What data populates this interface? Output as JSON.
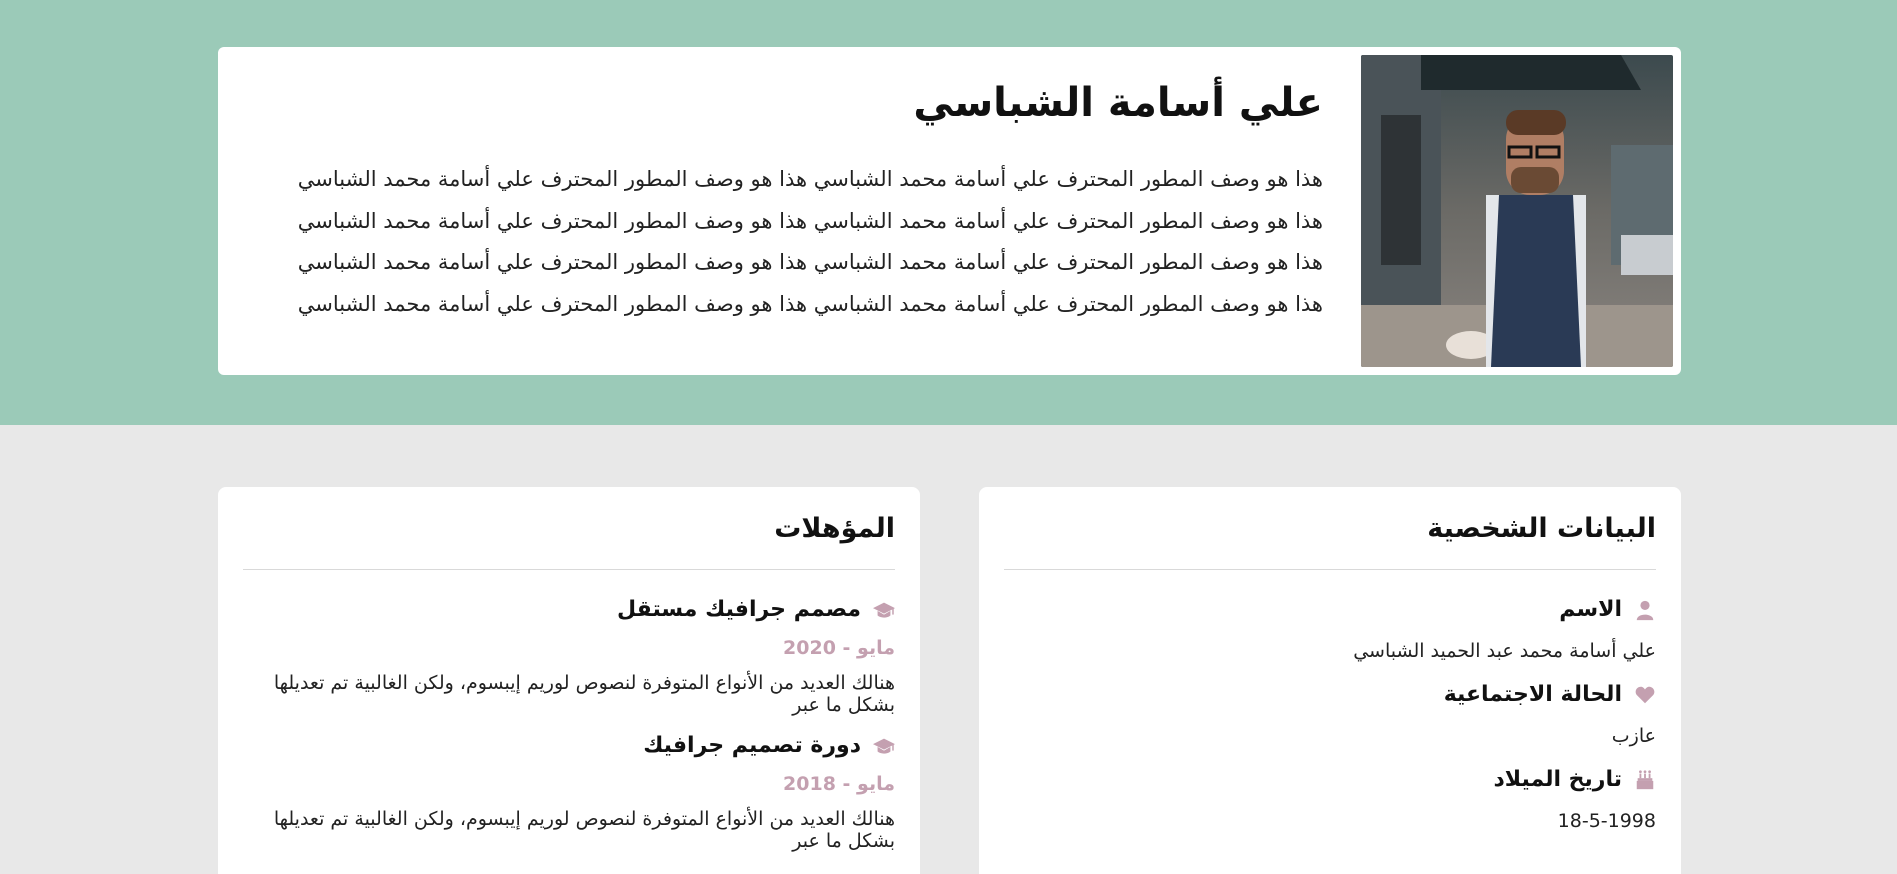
{
  "profile": {
    "name": "علي أسامة الشباسي",
    "description": "هذا هو وصف المطور المحترف علي أسامة محمد الشباسي هذا هو وصف المطور المحترف علي أسامة محمد الشباسي هذا هو وصف المطور المحترف علي أسامة محمد الشباسي هذا هو وصف المطور المحترف علي أسامة محمد الشباسي هذا هو وصف المطور المحترف علي أسامة محمد الشباسي هذا هو وصف المطور المحترف علي أسامة محمد الشباسي هذا هو وصف المطور المحترف علي أسامة محمد الشباسي هذا هو وصف المطور المحترف علي أسامة محمد الشباسي"
  },
  "personal": {
    "title": "البيانات الشخصية",
    "fields": [
      {
        "label": "الاسم",
        "value": "علي أسامة محمد عبد الحميد الشباسي",
        "icon": "user-icon"
      },
      {
        "label": "الحالة الاجتماعية",
        "value": "عازب",
        "icon": "heart-icon"
      },
      {
        "label": "تاريخ الميلاد",
        "value": "18-5-1998",
        "icon": "birthday-cake-icon"
      }
    ]
  },
  "qualifications": {
    "title": "المؤهلات",
    "items": [
      {
        "title": "مصمم جرافيك مستقل",
        "date": "مايو - 2020",
        "desc": "هنالك العديد من الأنواع المتوفرة لنصوص لوريم إيبسوم، ولكن الغالبية تم تعديلها بشكل ما عبر",
        "icon": "graduation-cap-icon"
      },
      {
        "title": "دورة تصميم جرافيك",
        "date": "مايو - 2018",
        "desc": "هنالك العديد من الأنواع المتوفرة لنصوص لوريم إيبسوم، ولكن الغالبية تم تعديلها بشكل ما عبر",
        "icon": "graduation-cap-icon"
      }
    ]
  },
  "colors": {
    "hero_background": "#9bcab8",
    "page_background": "#e8e8e8",
    "accent": "#c4a0b0"
  }
}
